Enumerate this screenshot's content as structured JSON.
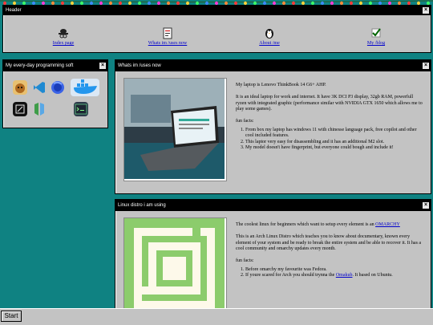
{
  "header": {
    "title": "Header",
    "close": "×",
    "nav": [
      {
        "label": "Index page",
        "icon": "spy-hat-icon"
      },
      {
        "label": "Whats im /uses now",
        "icon": "notepad-icon"
      },
      {
        "label": "About /me",
        "icon": "penguin-icon"
      },
      {
        "label": "My /blog",
        "icon": "checkmark-icon"
      }
    ]
  },
  "software": {
    "title": "My every-day programming soft",
    "close": "×",
    "icons": [
      "dog-icon",
      "vscode-icon",
      "firefox-icon",
      "docker-icon",
      "zed-icon",
      "neovim-icon",
      "terminal-icon"
    ]
  },
  "uses": {
    "title": "Whats im /uses now",
    "close": "×",
    "p1": "My laptop is Lenovo ThinkBook 14 G6+ AHP.",
    "p2": "It is an ideal laptop for work and internet. It have 3K DCI P3 display, 32gb RAM, powerfull ryzen with integrated graphic (performance similar with NVIDIA GTX 1650 which allows me to play some games).",
    "p3": "fun facts:",
    "facts": [
      "From box my laptop has windows 11 with chinesse language pack, free copilot and other cool included features.",
      "This laptor very easy for disassembling and it has an additional M2 slot.",
      "My model doesn't have fingerprint, but everyone could bough and include it!"
    ]
  },
  "distro": {
    "title": "Linux distro i am using",
    "close": "×",
    "p1_pre": "The coolest linux for beginners which want to setup every element is an ",
    "p1_link": "OMARCHY",
    "p2": "This is an Arch Linux Distro which teaches you to know about documentary, known every element of your system and be ready to break the entire system and be able to recover it. It has a cool community and omarchy updates every month.",
    "p3": "fun facts:",
    "fact1": "Before omarchy my favourite was Fedora.",
    "fact2_pre": "If youre scared for Arch you should trynna the ",
    "fact2_link": "Omakub",
    "fact2_post": ". It based on Ubuntu."
  },
  "taskbar": {
    "start": "Start"
  },
  "colors": {
    "desktop": "#0f8282",
    "window": "#c3c3c3",
    "titlebar": "#000000",
    "link": "#0000cc",
    "omarchy_green": "#8ccc6c"
  }
}
